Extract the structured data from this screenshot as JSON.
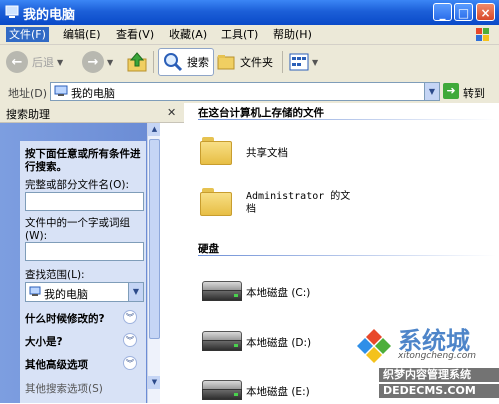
{
  "window": {
    "title": "我的电脑",
    "min": "_",
    "max": "□",
    "close": "×"
  },
  "menu": [
    "文件(F)",
    "编辑(E)",
    "查看(V)",
    "收藏(A)",
    "工具(T)",
    "帮助(H)"
  ],
  "toolbar": {
    "back": "后退",
    "search": "搜索",
    "folders": "文件夹"
  },
  "address": {
    "label": "地址(D)",
    "value": "我的电脑",
    "go": "转到"
  },
  "search_panel": {
    "title": "搜索助理",
    "prompt": "按下面任意或所有条件进行搜索。",
    "filename_label": "完整或部分文件名(O):",
    "filename_value": "",
    "phrase_label": "文件中的一个字或词组(W):",
    "phrase_value": "",
    "look_in_label": "查找范围(L):",
    "look_in_value": "我的电脑",
    "when_modified": "什么时候修改的?",
    "size": "大小是?",
    "advanced": "其他高级选项",
    "more_options": "其他搜索选项(S)"
  },
  "main": {
    "group_files": "在这台计算机上存储的文件",
    "items": [
      {
        "label": "共享文档"
      },
      {
        "label": "Administrator 的文档"
      }
    ],
    "group_drives": "硬盘",
    "drives": [
      {
        "label": "本地磁盘 (C:)"
      },
      {
        "label": "本地磁盘 (D:)"
      },
      {
        "label": "本地磁盘 (E:)"
      }
    ]
  },
  "watermark": {
    "brand": "系统城",
    "sub": "xitongcheng.com",
    "line1": "织梦内容管理系统",
    "line2": "DEDECMS.COM"
  },
  "colors": {
    "titlebar": "#0a4ac8",
    "panel": "#6d8fd6",
    "menu_active": "#316ac5"
  }
}
